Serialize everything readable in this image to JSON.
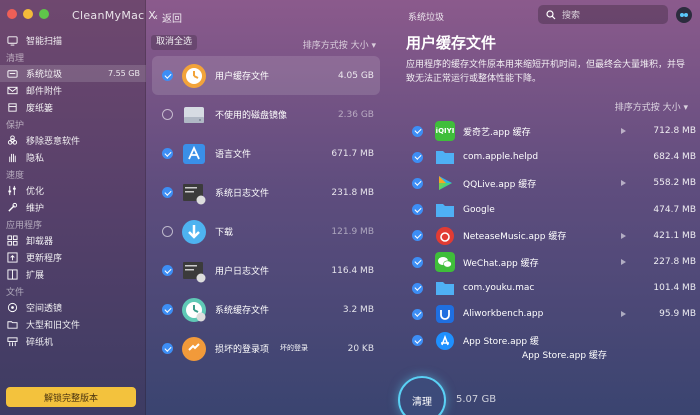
{
  "app": {
    "title": "CleanMyMac X"
  },
  "sidebar": {
    "top_item": {
      "label": "智能扫描",
      "icon": "scan-icon"
    },
    "sections": [
      {
        "title": "清理",
        "items": [
          {
            "label": "系统垃圾",
            "size": "7.55 GB",
            "active": true,
            "icon": "trash-bin-icon"
          },
          {
            "label": "邮件附件",
            "icon": "mail-icon"
          },
          {
            "label": "废纸篓",
            "icon": "trash-can-icon"
          }
        ]
      },
      {
        "title": "保护",
        "items": [
          {
            "label": "移除恶意软件",
            "icon": "biohazard-icon"
          },
          {
            "label": "隐私",
            "icon": "hand-icon"
          }
        ]
      },
      {
        "title": "速度",
        "items": [
          {
            "label": "优化",
            "icon": "sliders-icon"
          },
          {
            "label": "维护",
            "icon": "wrench-icon"
          }
        ]
      },
      {
        "title": "应用程序",
        "items": [
          {
            "label": "卸载器",
            "icon": "uninstaller-icon"
          },
          {
            "label": "更新程序",
            "icon": "updater-icon"
          },
          {
            "label": "扩展",
            "icon": "extensions-icon"
          }
        ]
      },
      {
        "title": "文件",
        "items": [
          {
            "label": "空间透镜",
            "icon": "space-lens-icon"
          },
          {
            "label": "大型和旧文件",
            "icon": "folder-icon"
          },
          {
            "label": "碎纸机",
            "icon": "shredder-icon"
          }
        ]
      }
    ],
    "unlock_label": "解锁完整版本"
  },
  "middle": {
    "back_label": "返回",
    "deselect_label": "取消全选",
    "sort_label": "排序方式按 大小",
    "items": [
      {
        "label": "用户缓存文件",
        "size": "4.05 GB",
        "checked": true,
        "selected": true,
        "icon": "user-cache-icon"
      },
      {
        "label": "不使用的磁盘镜像",
        "size": "2.36 GB",
        "checked": false,
        "icon": "disk-image-icon"
      },
      {
        "label": "语言文件",
        "size": "671.7 MB",
        "checked": true,
        "icon": "language-files-icon"
      },
      {
        "label": "系统日志文件",
        "size": "231.8 MB",
        "checked": true,
        "icon": "system-log-icon"
      },
      {
        "label": "下载",
        "size": "121.9 MB",
        "checked": false,
        "icon": "downloads-icon"
      },
      {
        "label": "用户日志文件",
        "size": "116.4 MB",
        "checked": true,
        "icon": "user-log-icon"
      },
      {
        "label": "系统缓存文件",
        "size": "3.2 MB",
        "checked": true,
        "icon": "system-cache-icon"
      },
      {
        "label": "损坏的登录项",
        "size": "20 KB",
        "checked": true,
        "icon": "broken-login-icon"
      }
    ],
    "artifact_text": "坏的登录"
  },
  "right": {
    "top_title": "系统垃圾",
    "search_placeholder": "搜索",
    "heading": "用户缓存文件",
    "description": "应用程序的缓存文件原本用来缩短开机时间，但最终会大量堆积，并导致无法正常运行或整体性能下降。",
    "sort_label": "排序方式按 大小",
    "items": [
      {
        "label": "爱奇艺.app 缓存",
        "size": "712.8 MB",
        "expandable": true,
        "icon": "iqiyi-icon",
        "color": "#3fbe3a"
      },
      {
        "label": "com.apple.helpd",
        "size": "682.4 MB",
        "expandable": false,
        "icon": "folder-icon",
        "color": "#4fb0f5"
      },
      {
        "label": "QQLive.app 缓存",
        "size": "558.2 MB",
        "expandable": true,
        "icon": "qqlive-icon",
        "color": "#ffffff"
      },
      {
        "label": "Google",
        "size": "474.7 MB",
        "expandable": false,
        "icon": "folder-icon",
        "color": "#4fb0f5"
      },
      {
        "label": "NeteaseMusic.app 缓存",
        "size": "421.1 MB",
        "expandable": true,
        "icon": "netease-music-icon",
        "color": "#e23b33"
      },
      {
        "label": "WeChat.app 缓存",
        "size": "227.8 MB",
        "expandable": true,
        "icon": "wechat-icon",
        "color": "#3fbe3a"
      },
      {
        "label": "com.youku.mac",
        "size": "101.4 MB",
        "expandable": false,
        "icon": "folder-icon",
        "color": "#4fb0f5"
      },
      {
        "label": "Aliworkbench.app",
        "size": "95.9 MB",
        "expandable": true,
        "icon": "aliworkbench-icon",
        "color": "#1f6fe0"
      },
      {
        "label": "App Store.app 缓",
        "size": "",
        "expandable": false,
        "icon": "app-store-icon",
        "color": "#1e90ff"
      }
    ],
    "overlap_text": "App Store.app 缓存"
  },
  "footer": {
    "clean_label": "清理",
    "total_size": "5.07 GB"
  }
}
